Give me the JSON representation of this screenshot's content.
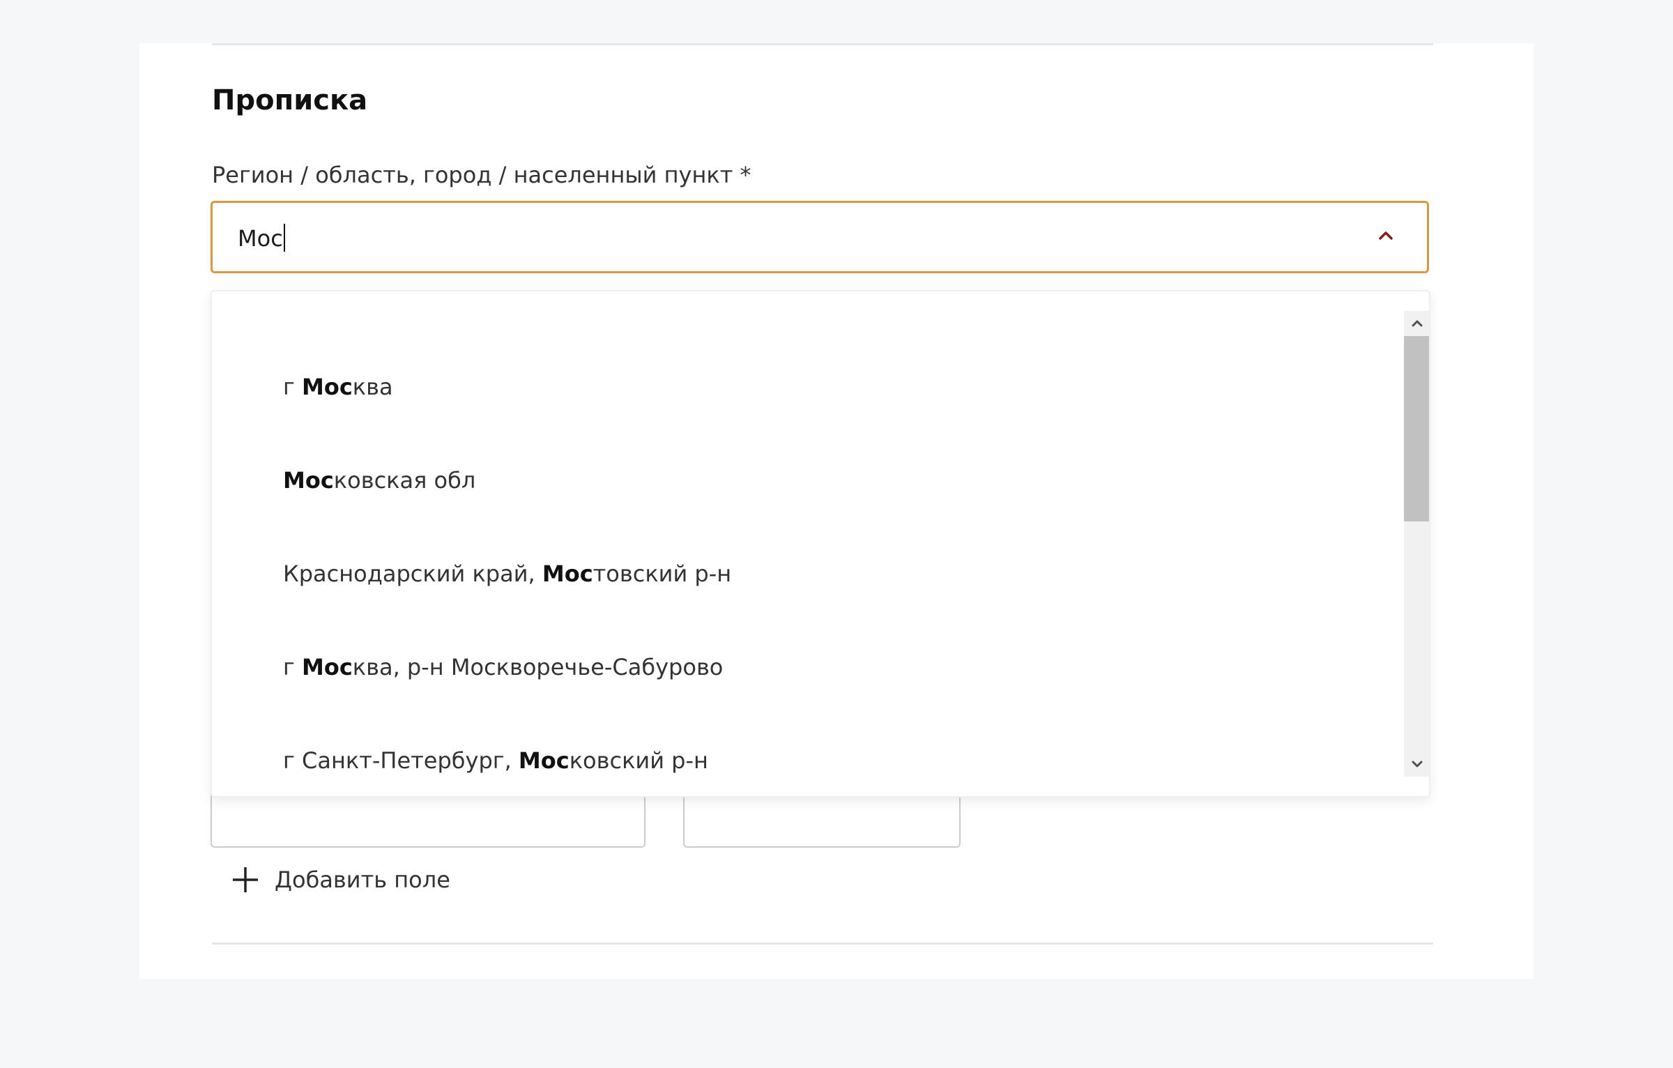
{
  "section": {
    "title": "Прописка"
  },
  "region_field": {
    "label": "Регион / область, город / населенный пункт *",
    "value": "Мос"
  },
  "suggestions": [
    {
      "prefix": "г ",
      "match": "Мос",
      "suffix": "ква"
    },
    {
      "prefix": "",
      "match": "Мос",
      "suffix": "ковская обл"
    },
    {
      "prefix": "Краснодарский край, ",
      "match": "Мос",
      "suffix": "товский р-н"
    },
    {
      "prefix": "г ",
      "match": "Мос",
      "suffix": "ква, р-н Москворечье-Сабурово"
    },
    {
      "prefix": "г Санкт-Петербург, ",
      "match": "Мос",
      "suffix": "ковский р-н"
    }
  ],
  "add_field": {
    "label": "Добавить поле"
  },
  "colors": {
    "focus_border": "#d9983f",
    "chevron": "#8b1a1a",
    "divider": "#e4e6ea"
  },
  "icons": {
    "toggle": "chevron-up-icon",
    "add": "plus-icon"
  }
}
